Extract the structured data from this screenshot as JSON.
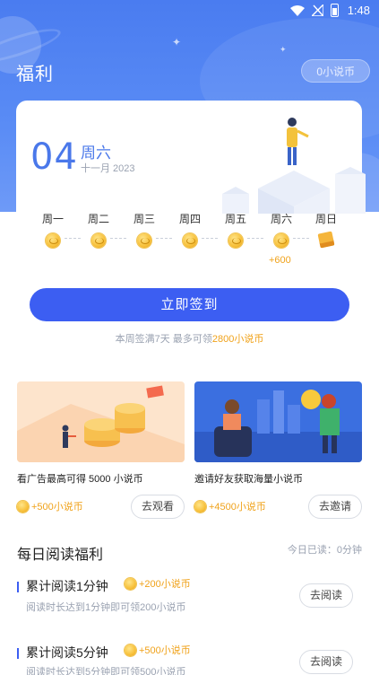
{
  "status_bar": {
    "time": "1:48"
  },
  "header": {
    "title": "福利",
    "coin_balance": "0小说币"
  },
  "sign_in": {
    "day": "04",
    "weekday": "周六",
    "month_year": "十一月 2023",
    "days": [
      {
        "label": "周一",
        "icon": "coin-icon"
      },
      {
        "label": "周二",
        "icon": "coin-icon"
      },
      {
        "label": "周三",
        "icon": "coin-icon"
      },
      {
        "label": "周四",
        "icon": "coin-icon"
      },
      {
        "label": "周五",
        "icon": "coin-icon"
      },
      {
        "label": "周六",
        "icon": "coin-icon"
      },
      {
        "label": "周日",
        "icon": "gift-icon"
      }
    ],
    "bonus_today": "+600",
    "button_label": "立即签到",
    "note_prefix": "本周签满7天 最多可领",
    "note_highlight": "2800小说币"
  },
  "tasks": [
    {
      "title": "看广告最高可得 5000 小说币",
      "reward": "+500小说币",
      "button": "去观看"
    },
    {
      "title": "邀请好友获取海量小说币",
      "reward": "+4500小说币",
      "button": "去邀请"
    }
  ],
  "daily_reading": {
    "title": "每日阅读福利",
    "today_read": "今日已读：0分钟",
    "items": [
      {
        "title": "累计阅读1分钟",
        "reward": "+200小说币",
        "desc": "阅读时长达到1分钟即可领200小说币",
        "button": "去阅读"
      },
      {
        "title": "累计阅读5分钟",
        "reward": "+500小说币",
        "desc": "阅读时长达到5分钟即可领500小说币",
        "button": "去阅读"
      }
    ]
  },
  "colors": {
    "primary": "#3c5ef2",
    "hero": "#4a7cf0",
    "gold": "#f0a21a",
    "muted": "#9aa2b1"
  }
}
